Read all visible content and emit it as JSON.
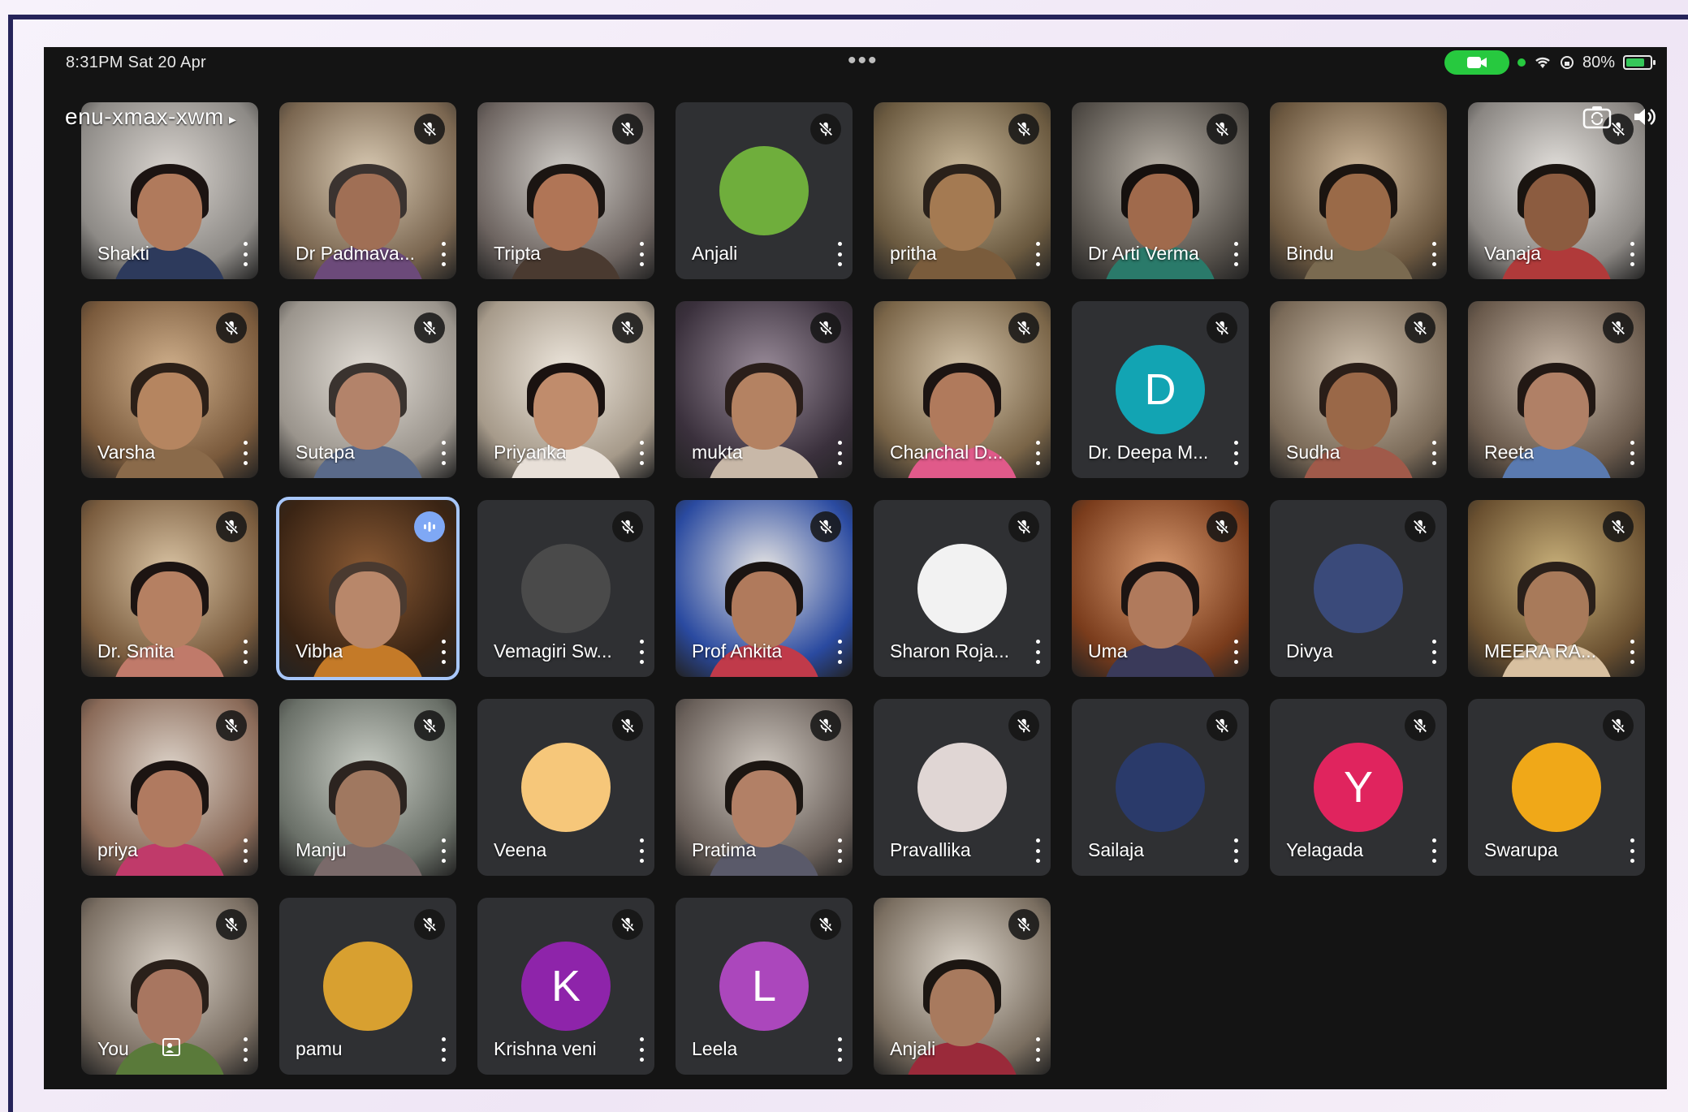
{
  "status_bar": {
    "time": "8:31PM  Sat 20 Apr",
    "dots": "•••",
    "battery": "80%",
    "battery_level": 0.8
  },
  "meeting": {
    "code": "enu-xmax-xwm",
    "chevron": "▸"
  },
  "colors": {
    "active_outline": "#a8c7fa",
    "tile_bg": "#2f3033",
    "status_green": "#27c93f"
  },
  "participants": [
    {
      "name": "Shakti",
      "type": "cam",
      "c1": "#d9d4cf",
      "c2": "#8d8a86",
      "skin": "#b07a5c",
      "hair": "#1c1412",
      "cloth": "#2d3a5c"
    },
    {
      "name": "Dr Padmava...",
      "type": "cam",
      "muted": true,
      "c1": "#d8c9b2",
      "c2": "#7a6650",
      "skin": "#a06f55",
      "hair": "#3b3330",
      "cloth": "#6c4a7a"
    },
    {
      "name": "Tripta",
      "type": "cam",
      "muted": true,
      "c1": "#d0cdc8",
      "c2": "#6d6460",
      "skin": "#b07556",
      "hair": "#1b1512",
      "cloth": "#4a3a30"
    },
    {
      "name": "Anjali",
      "type": "avatar",
      "muted": true,
      "avatar_bg": "#6fae3c",
      "avatar_text": ""
    },
    {
      "name": "pritha",
      "type": "cam",
      "muted": true,
      "c1": "#c9b89a",
      "c2": "#6b5a40",
      "skin": "#a47a52",
      "hair": "#2a211a",
      "cloth": "#7a5c3c"
    },
    {
      "name": "Dr Arti Verma",
      "type": "cam",
      "muted": true,
      "c1": "#b9b2a8",
      "c2": "#55504a",
      "skin": "#a06a4c",
      "hair": "#15100e",
      "cloth": "#2a7a6a"
    },
    {
      "name": "Bindu",
      "type": "cam",
      "c1": "#cdb79a",
      "c2": "#6c5840",
      "skin": "#9a6a48",
      "hair": "#1b1410",
      "cloth": "#7a6a50"
    },
    {
      "name": "Vanaja",
      "type": "cam",
      "muted": true,
      "c1": "#e3e0dc",
      "c2": "#8a8682",
      "skin": "#8c5c40",
      "hair": "#1a1410",
      "cloth": "#b03a3a"
    },
    {
      "name": "Varsha",
      "type": "cam",
      "muted": true,
      "c1": "#d0b08c",
      "c2": "#7a5a3c",
      "skin": "#b58560",
      "hair": "#2c2018",
      "cloth": "#8a6a4a"
    },
    {
      "name": "Sutapa",
      "type": "cam",
      "muted": true,
      "c1": "#e2ddd6",
      "c2": "#9a948c",
      "skin": "#b3836a",
      "hair": "#3a332f",
      "cloth": "#5a6a8a"
    },
    {
      "name": "Priyanka",
      "type": "cam",
      "muted": true,
      "c1": "#ede6dc",
      "c2": "#a69a8a",
      "skin": "#c08c6c",
      "hair": "#1a1210",
      "cloth": "#e8e0d8"
    },
    {
      "name": "mukta",
      "type": "cam",
      "muted": true,
      "c1": "#9a8c9a",
      "c2": "#3a303c",
      "skin": "#b48262",
      "hair": "#2a1e1a",
      "cloth": "#c8b8a8"
    },
    {
      "name": "Chanchal D...",
      "type": "cam",
      "muted": true,
      "c1": "#d4c4aa",
      "c2": "#7a6548",
      "skin": "#b07a5c",
      "hair": "#1c1412",
      "cloth": "#e05a8a"
    },
    {
      "name": "Dr. Deepa M...",
      "type": "avatar",
      "muted": true,
      "avatar_bg": "#12a4b3",
      "avatar_text": "D"
    },
    {
      "name": "Sudha",
      "type": "cam",
      "muted": true,
      "c1": "#cfc1ae",
      "c2": "#7a6a58",
      "skin": "#9a6848",
      "hair": "#2a1e18",
      "cloth": "#a05a4a"
    },
    {
      "name": "Reeta",
      "type": "cam",
      "muted": true,
      "c1": "#c8b8a8",
      "c2": "#6a5a4c",
      "skin": "#b08066",
      "hair": "#221814",
      "cloth": "#5a7ab0"
    },
    {
      "name": "Dr. Smita",
      "type": "cam",
      "muted": true,
      "c1": "#d8c2a2",
      "c2": "#7a5c3e",
      "skin": "#b58062",
      "hair": "#1c1412",
      "cloth": "#c07a6a"
    },
    {
      "name": "Vibha",
      "type": "cam",
      "speaking": true,
      "c1": "#8a5a34",
      "c2": "#3a2414",
      "skin": "#b8876a",
      "hair": "#4a3a30",
      "cloth": "#c47a28"
    },
    {
      "name": "Vemagiri Sw...",
      "type": "avatar",
      "muted": true,
      "avatar_bg": "#4a4a4a",
      "avatar_text": ""
    },
    {
      "name": "Prof Ankita",
      "type": "cam",
      "muted": true,
      "c1": "#e8e6e4",
      "c2": "#2a4aa0",
      "skin": "#b07a5c",
      "hair": "#1a1412",
      "cloth": "#c03a4a"
    },
    {
      "name": "Sharon Roja...",
      "type": "avatar",
      "muted": true,
      "avatar_bg": "#f2f2f2",
      "avatar_text": ""
    },
    {
      "name": "Uma",
      "type": "cam",
      "muted": true,
      "c1": "#d89a70",
      "c2": "#7a3c1c",
      "skin": "#b07a5c",
      "hair": "#1c1412",
      "cloth": "#3a3a5a"
    },
    {
      "name": "Divya",
      "type": "avatar",
      "muted": true,
      "avatar_bg": "#3a4a7a",
      "avatar_text": ""
    },
    {
      "name": "MEERA RA...",
      "type": "cam",
      "muted": true,
      "c1": "#c8b07a",
      "c2": "#6a5030",
      "skin": "#a87a5a",
      "hair": "#2a201a",
      "cloth": "#d8c0a0"
    },
    {
      "name": "priya",
      "type": "cam",
      "muted": true,
      "c1": "#dcd2c8",
      "c2": "#8a6a58",
      "skin": "#b07a60",
      "hair": "#1c1412",
      "cloth": "#c03a6a"
    },
    {
      "name": "Manju",
      "type": "cam",
      "muted": true,
      "c1": "#c8ccc4",
      "c2": "#6a7068",
      "skin": "#a07860",
      "hair": "#2c2420",
      "cloth": "#7a6a6a"
    },
    {
      "name": "Veena",
      "type": "avatar",
      "muted": true,
      "avatar_bg": "#f6c77a",
      "avatar_text": ""
    },
    {
      "name": "Pratima",
      "type": "cam",
      "muted": true,
      "c1": "#cfc8c0",
      "c2": "#6a605a",
      "skin": "#b28066",
      "hair": "#1c1612",
      "cloth": "#5a5a6a"
    },
    {
      "name": "Pravallika",
      "type": "avatar",
      "muted": true,
      "avatar_bg": "#e0d6d4",
      "avatar_text": ""
    },
    {
      "name": "Sailaja",
      "type": "avatar",
      "muted": true,
      "avatar_bg": "#2a3a6a",
      "avatar_text": ""
    },
    {
      "name": "Yelagada",
      "type": "avatar",
      "muted": true,
      "avatar_bg": "#e0245e",
      "avatar_text": "Y"
    },
    {
      "name": "Swarupa",
      "type": "avatar",
      "muted": true,
      "avatar_bg": "#f0a818",
      "avatar_text": ""
    },
    {
      "name": "You",
      "type": "cam",
      "muted": true,
      "self": true,
      "c1": "#d8d0c6",
      "c2": "#7a6e62",
      "skin": "#a87660",
      "hair": "#2a201a",
      "cloth": "#5a7a3a"
    },
    {
      "name": "pamu",
      "type": "avatar",
      "muted": true,
      "avatar_bg": "#d8a030",
      "avatar_text": ""
    },
    {
      "name": "Krishna veni",
      "type": "avatar",
      "muted": true,
      "avatar_bg": "#8e24aa",
      "avatar_text": "K"
    },
    {
      "name": "Leela",
      "type": "avatar",
      "muted": true,
      "avatar_bg": "#ab47bc",
      "avatar_text": "L"
    },
    {
      "name": "Anjali",
      "type": "cam",
      "muted": true,
      "c1": "#ddd6cc",
      "c2": "#7a6e60",
      "skin": "#a87a5e",
      "hair": "#1c1612",
      "cloth": "#9a2a3a"
    }
  ]
}
